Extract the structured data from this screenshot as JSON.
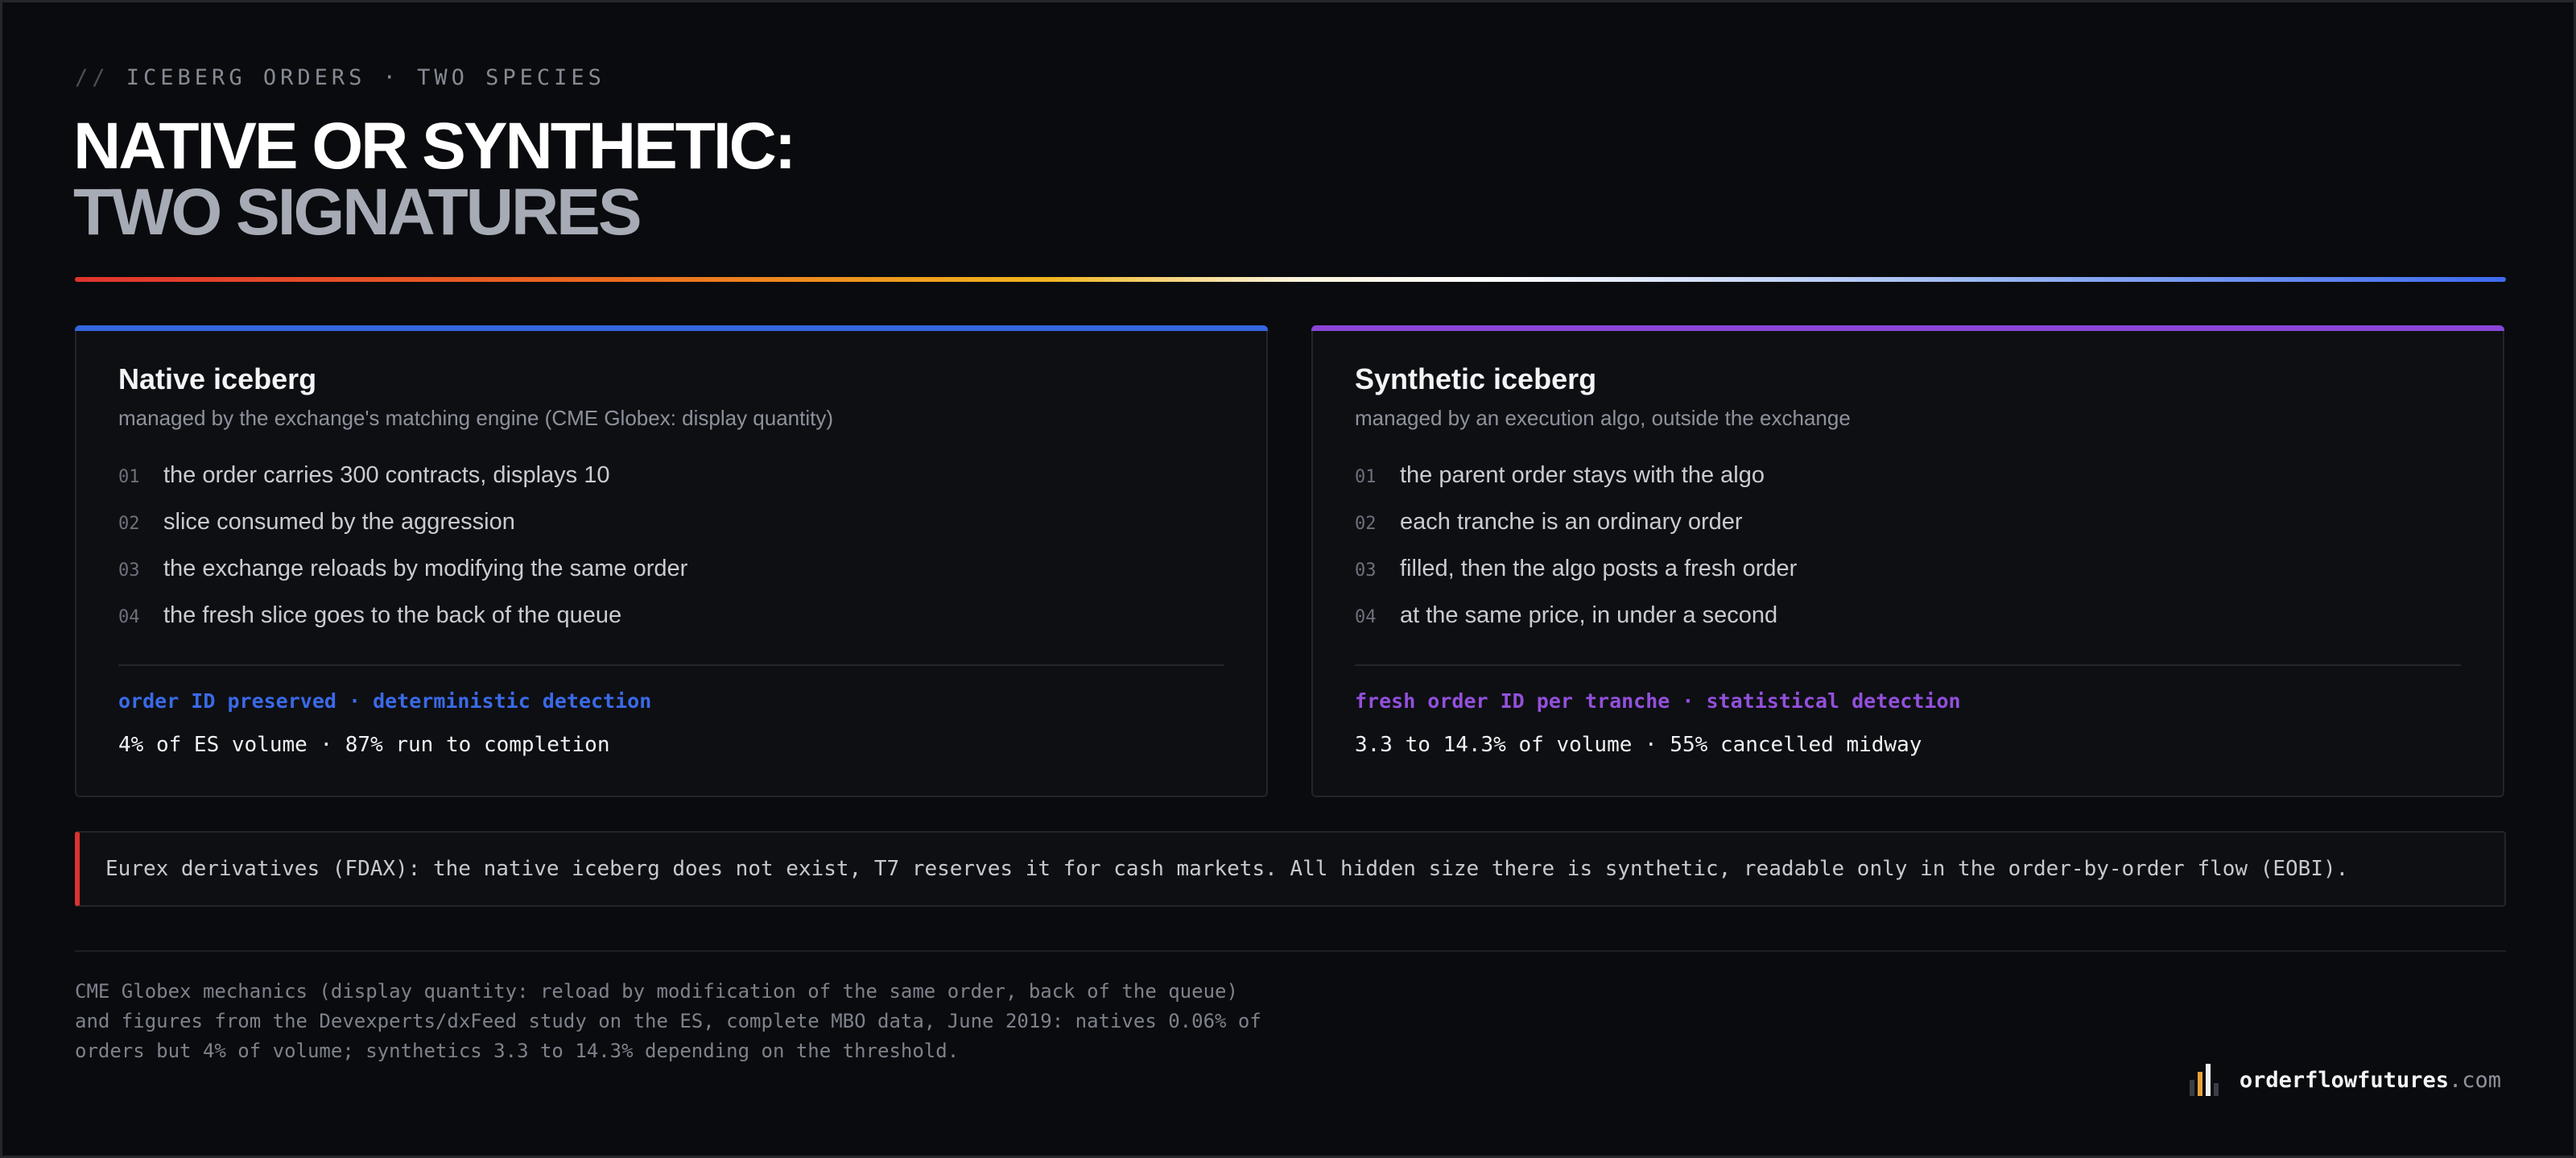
{
  "header": {
    "kicker_prefix": "//",
    "kicker": "ICEBERG ORDERS · TWO SPECIES",
    "title_line1": "NATIVE OR SYNTHETIC:",
    "title_line2": "TWO SIGNATURES"
  },
  "cards": {
    "native": {
      "accent": "#3566e0",
      "title": "Native iceberg",
      "subtitle": "managed by the exchange's matching engine (CME Globex: display quantity)",
      "steps": [
        {
          "num": "01",
          "text": "the order carries 300 contracts, displays 10"
        },
        {
          "num": "02",
          "text": "slice consumed by the aggression"
        },
        {
          "num": "03",
          "text": "the exchange reloads by modifying the same order"
        },
        {
          "num": "04",
          "text": "the fresh slice goes to the back of the queue"
        }
      ],
      "tag": "order ID preserved · deterministic detection",
      "stat": "4% of ES volume · 87% run to completion"
    },
    "synthetic": {
      "accent": "#8a45d6",
      "title": "Synthetic iceberg",
      "subtitle": "managed by an execution algo, outside the exchange",
      "steps": [
        {
          "num": "01",
          "text": "the parent order stays with the algo"
        },
        {
          "num": "02",
          "text": "each tranche is an ordinary order"
        },
        {
          "num": "03",
          "text": "filled, then the algo posts a fresh order"
        },
        {
          "num": "04",
          "text": "at the same price, in under a second"
        }
      ],
      "tag": "fresh order ID per tranche · statistical detection",
      "stat": "3.3 to 14.3% of volume · 55% cancelled midway"
    }
  },
  "callout": {
    "accent": "#d9342f",
    "text": "Eurex derivatives (FDAX): the native iceberg does not exist, T7 reserves it for cash markets. All hidden size there is synthetic, readable only in the order-by-order flow (EOBI)."
  },
  "footnote": "CME Globex mechanics (display quantity: reload by modification of the same order, back of the queue) and figures from the Devexperts/dxFeed study on the ES, complete MBO data, June 2019: natives 0.06% of orders but 4% of volume; synthetics 3.3 to 14.3% depending on the threshold.",
  "brand": {
    "name": "orderflowfutures",
    "tld": ".com",
    "logo_icon": "bar-chart-logo-icon"
  }
}
